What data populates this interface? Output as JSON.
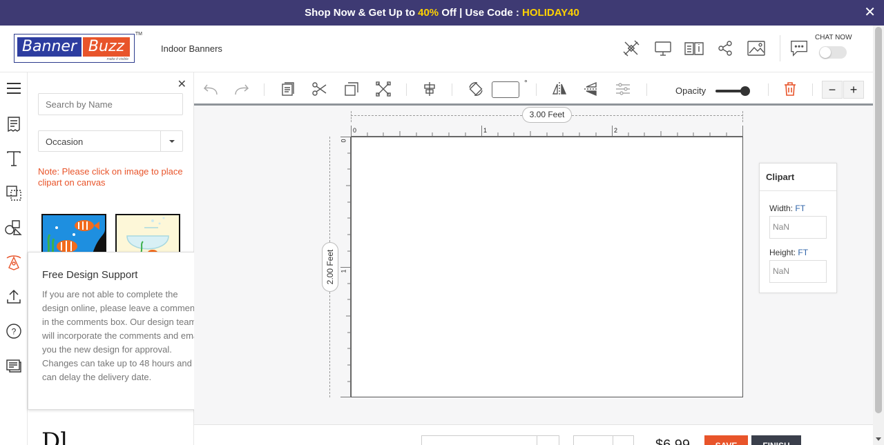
{
  "promo": {
    "prefix": "Shop Now & Get Up to ",
    "discount": "40%",
    "middle": " Off | Use Code : ",
    "code": "HOLIDAY40",
    "close_label": "✕"
  },
  "header": {
    "logo_part1": "Banner",
    "logo_part2": "Buzz",
    "logo_tagline": "make it visible",
    "logo_tm": "TM",
    "breadcrumb": "Indoor Banners",
    "chat_label": "CHAT NOW",
    "icons": [
      "design-tools-icon",
      "monitor-preview-icon",
      "product-info-icon",
      "share-icon",
      "image-icon",
      "chat-icon"
    ]
  },
  "sidebar_nav": {
    "icons": [
      "menu-icon",
      "templates-icon",
      "text-icon",
      "shapes-icon",
      "elements-icon",
      "clipart-icon",
      "upload-icon",
      "help-icon",
      "comments-icon"
    ]
  },
  "panel": {
    "close_label": "✕",
    "search_placeholder": "Search by Name",
    "select_value": "Occasion",
    "note": "Note: Please click on image to place clipart on canvas",
    "bottom_partial_text": "Dl"
  },
  "popup": {
    "title": "Free Design Support",
    "body": "If you are not able to complete the design online, please leave a comments in the comments box. Our design team will incorporate the comments and email you the new design for approval. Changes can take up to 48 hours and can delay the delivery date.",
    "close_label": "✕"
  },
  "toolbar": {
    "degree_symbol": "°",
    "opacity_label": "Opacity",
    "opacity_value": 1.0,
    "zoom_out": "−",
    "zoom_in": "+"
  },
  "canvas": {
    "width_label": "3.00 Feet",
    "height_label": "2.00 Feet",
    "hruler_numbers": [
      "0",
      "1",
      "2"
    ],
    "vruler_numbers": [
      "0",
      "1"
    ]
  },
  "clipart_panel": {
    "title": "Clipart",
    "width_label": "Width:",
    "height_label": "Height:",
    "unit": "FT",
    "width_value": "NaN",
    "height_value": "NaN"
  },
  "footer": {
    "price": "$6.99",
    "save_label": "SAVE",
    "finish_label": "FINISH"
  },
  "colors": {
    "promo_bg": "#3e3a73",
    "promo_highlight": "#ffd200",
    "accent_orange": "#e8542a",
    "brand_blue": "#2d3da0"
  }
}
